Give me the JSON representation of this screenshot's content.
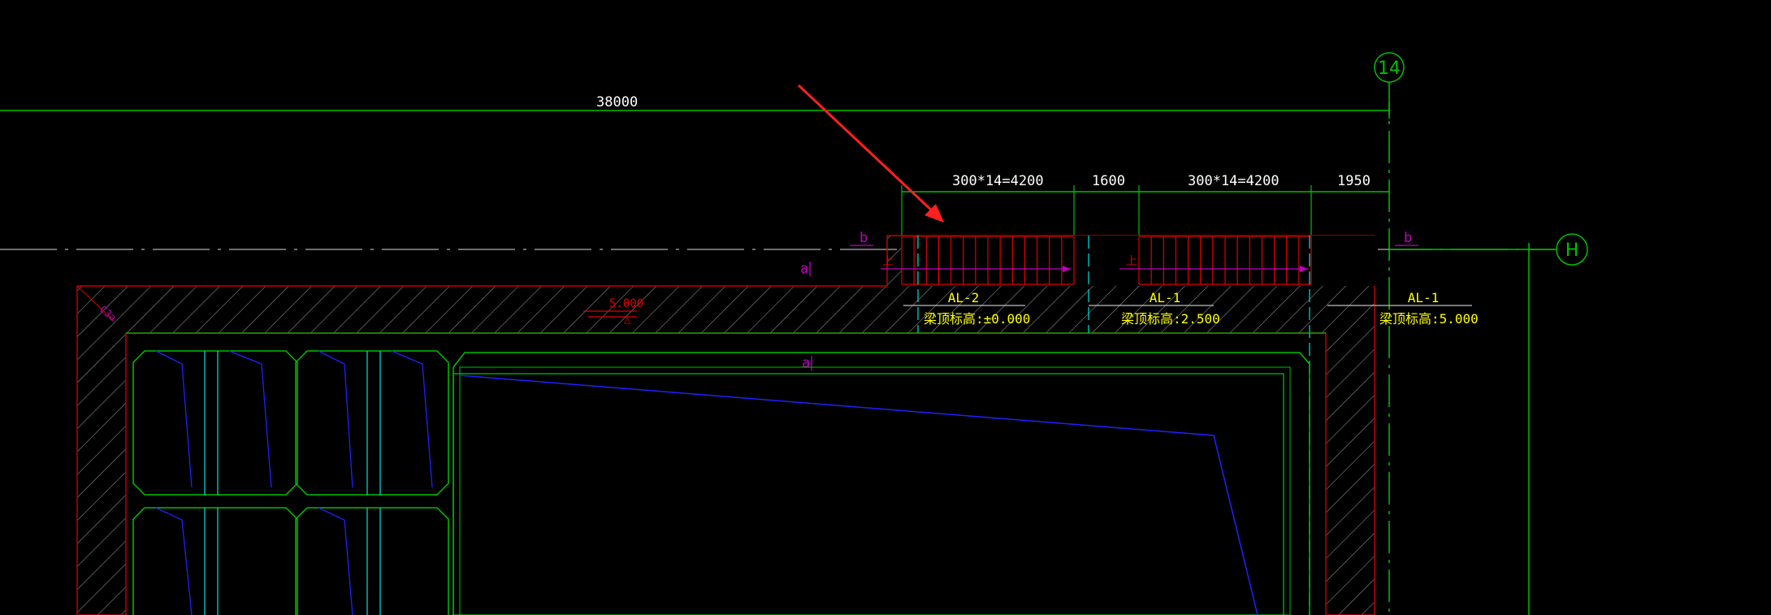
{
  "dimensions": {
    "overall": "38000",
    "segment_1": "300*14=4200",
    "segment_2": "1600",
    "segment_3": "300*14=4200",
    "segment_4": "1950"
  },
  "grid_axes": {
    "vertical": "14",
    "horizontal": "H"
  },
  "section_marks": {
    "b_left": "b",
    "b_right": "b",
    "a_top": "a",
    "a_inner": "a"
  },
  "beams": [
    {
      "name": "AL-2",
      "elevation": "梁顶标高:±0.000"
    },
    {
      "name": "AL-1",
      "elevation": "梁顶标高:2.500"
    },
    {
      "name": "AL-1",
      "elevation": "梁顶标高:5.000"
    }
  ],
  "small_marks": {
    "corner": "C3a",
    "level": "5.000",
    "level_sub": "△",
    "stair_mark_1": "上",
    "stair_mark_2": "上"
  },
  "colors": {
    "background": "#000000",
    "dimension_line": "#00c000",
    "wall_outline": "#c00000",
    "stair": "#e00000",
    "arrow": "#ff2020",
    "beam_text": "#ffff00",
    "section_text": "#c000c0",
    "structure": "#00c000",
    "cyan_lines": "#00d0d0",
    "blue_lines": "#2020ff"
  }
}
